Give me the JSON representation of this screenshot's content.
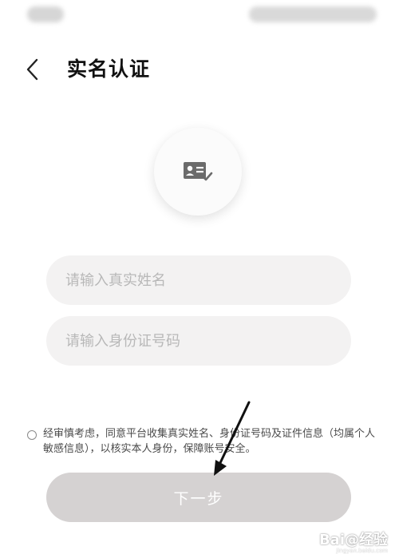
{
  "header": {
    "title": "实名认证"
  },
  "form": {
    "name_placeholder": "请输入真实姓名",
    "idno_placeholder": "请输入身份证号码",
    "agreement_text": "经审慎考虑，同意平台收集真实姓名、身份证号码及证件信息（均属个人敏感信息），以核实本人身份，保障账号安全。",
    "next_label": "下一步"
  },
  "watermark": {
    "brand": "Bai@经验",
    "url": "jingyan.baidu.com"
  },
  "icons": {
    "back": "chevron-left-icon",
    "card": "id-card-check-icon",
    "arrow": "annotation-arrow-icon"
  },
  "colors": {
    "input_bg": "#f3f2f2",
    "button_bg": "#d5d2d2",
    "placeholder": "#b8b8b8",
    "icon_gray": "#6b6b6b"
  }
}
